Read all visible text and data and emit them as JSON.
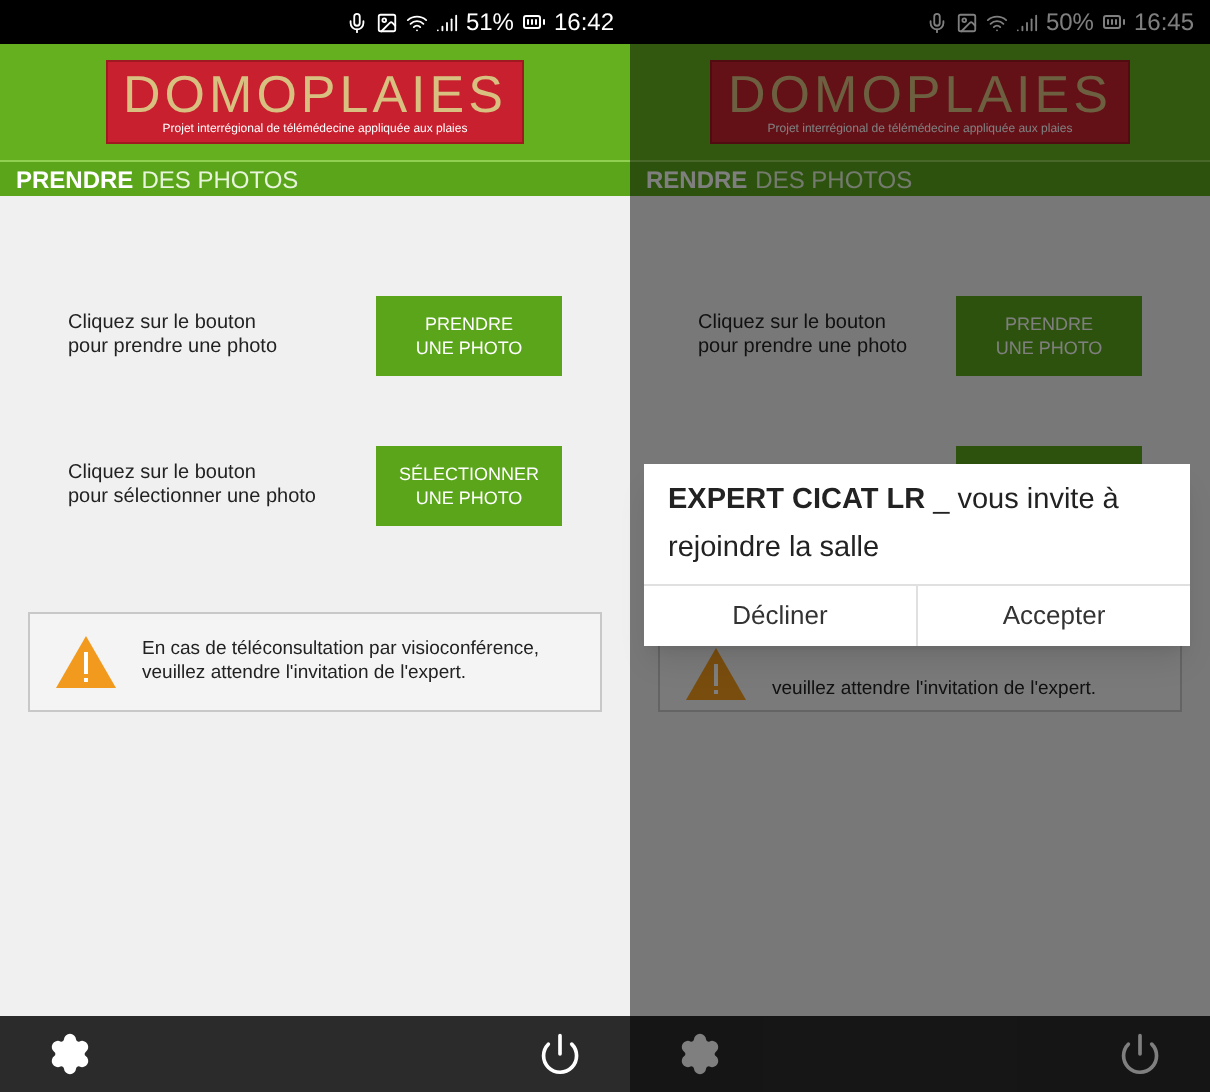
{
  "screens": [
    {
      "dimmed": false,
      "status": {
        "battery": "51%",
        "time": "16:42"
      },
      "logo": {
        "name": "DOMOPLAIES",
        "tagline": "Projet interrégional de télémédecine appliquée aux plaies"
      },
      "title_bold": "PRENDRE",
      "title_rest": "DES PHOTOS",
      "rows": [
        {
          "lines": [
            "Cliquez sur le bouton",
            "pour prendre une photo"
          ],
          "button": [
            "PRENDRE",
            "UNE PHOTO"
          ]
        },
        {
          "lines": [
            "Cliquez sur le bouton",
            "pour sélectionner une photo"
          ],
          "button": [
            "SÉLECTIONNER",
            "UNE PHOTO"
          ]
        }
      ],
      "notice": [
        "En cas de téléconsultation par visioconférence,",
        "veuillez attendre l'invitation de l'expert."
      ]
    },
    {
      "dimmed": true,
      "status": {
        "battery": "50%",
        "time": "16:45"
      },
      "logo": {
        "name": "DOMOPLAIES",
        "tagline": "Projet interrégional de télémédecine appliquée aux plaies"
      },
      "title_bold": "RENDRE",
      "title_rest": "DES PHOTOS",
      "rows": [
        {
          "lines": [
            "Cliquez sur le bouton",
            "pour prendre une photo"
          ],
          "button": [
            "PRENDRE",
            "UNE PHOTO"
          ]
        },
        {
          "button": []
        }
      ],
      "notice": [
        "veuillez attendre l'invitation de l'expert."
      ],
      "dialog": {
        "message": "**EXPERT CICAT LR** _ vous invite à rejoindre la salle",
        "buttons": [
          "Décliner",
          "Accepter"
        ]
      }
    }
  ]
}
